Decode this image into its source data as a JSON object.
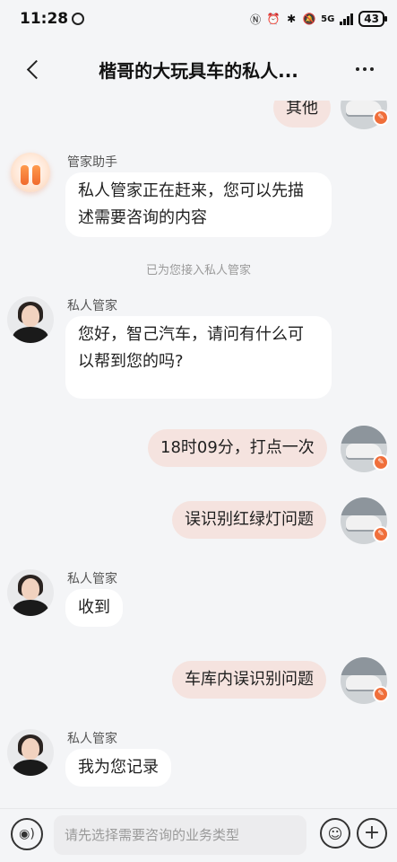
{
  "status_bar": {
    "time": "11:28",
    "network": "5G",
    "battery": "43"
  },
  "header": {
    "title": "楷哥的大玩具车的私人..."
  },
  "messages": [
    {
      "side": "user",
      "text": "其他"
    },
    {
      "side": "bot",
      "sender": "管家助手",
      "text": "私人管家正在赶来，您可以先描述需要咨询的内容"
    },
    {
      "side": "system",
      "text": "已为您接入私人管家"
    },
    {
      "side": "agent",
      "sender": "私人管家",
      "text": "您好，智己汽车，请问有什么可以帮到您的吗?"
    },
    {
      "side": "user",
      "text": "18时09分，打点一次"
    },
    {
      "side": "user",
      "text": "误识别红绿灯问题"
    },
    {
      "side": "agent",
      "sender": "私人管家",
      "text": "收到"
    },
    {
      "side": "user",
      "text": "车库内误识别问题"
    },
    {
      "side": "agent",
      "sender": "私人管家",
      "text": "我为您记录"
    }
  ],
  "input_bar": {
    "placeholder": "请先选择需要咨询的业务类型"
  },
  "colors": {
    "user_bubble": "#f5e3df",
    "agent_bubble": "#ffffff",
    "badge": "#f06f3b",
    "background": "#f4f5f7"
  },
  "icons": [
    "back-chevron-icon",
    "more-icon",
    "voice-icon",
    "emoji-icon",
    "plus-icon",
    "edit-badge-icon"
  ]
}
